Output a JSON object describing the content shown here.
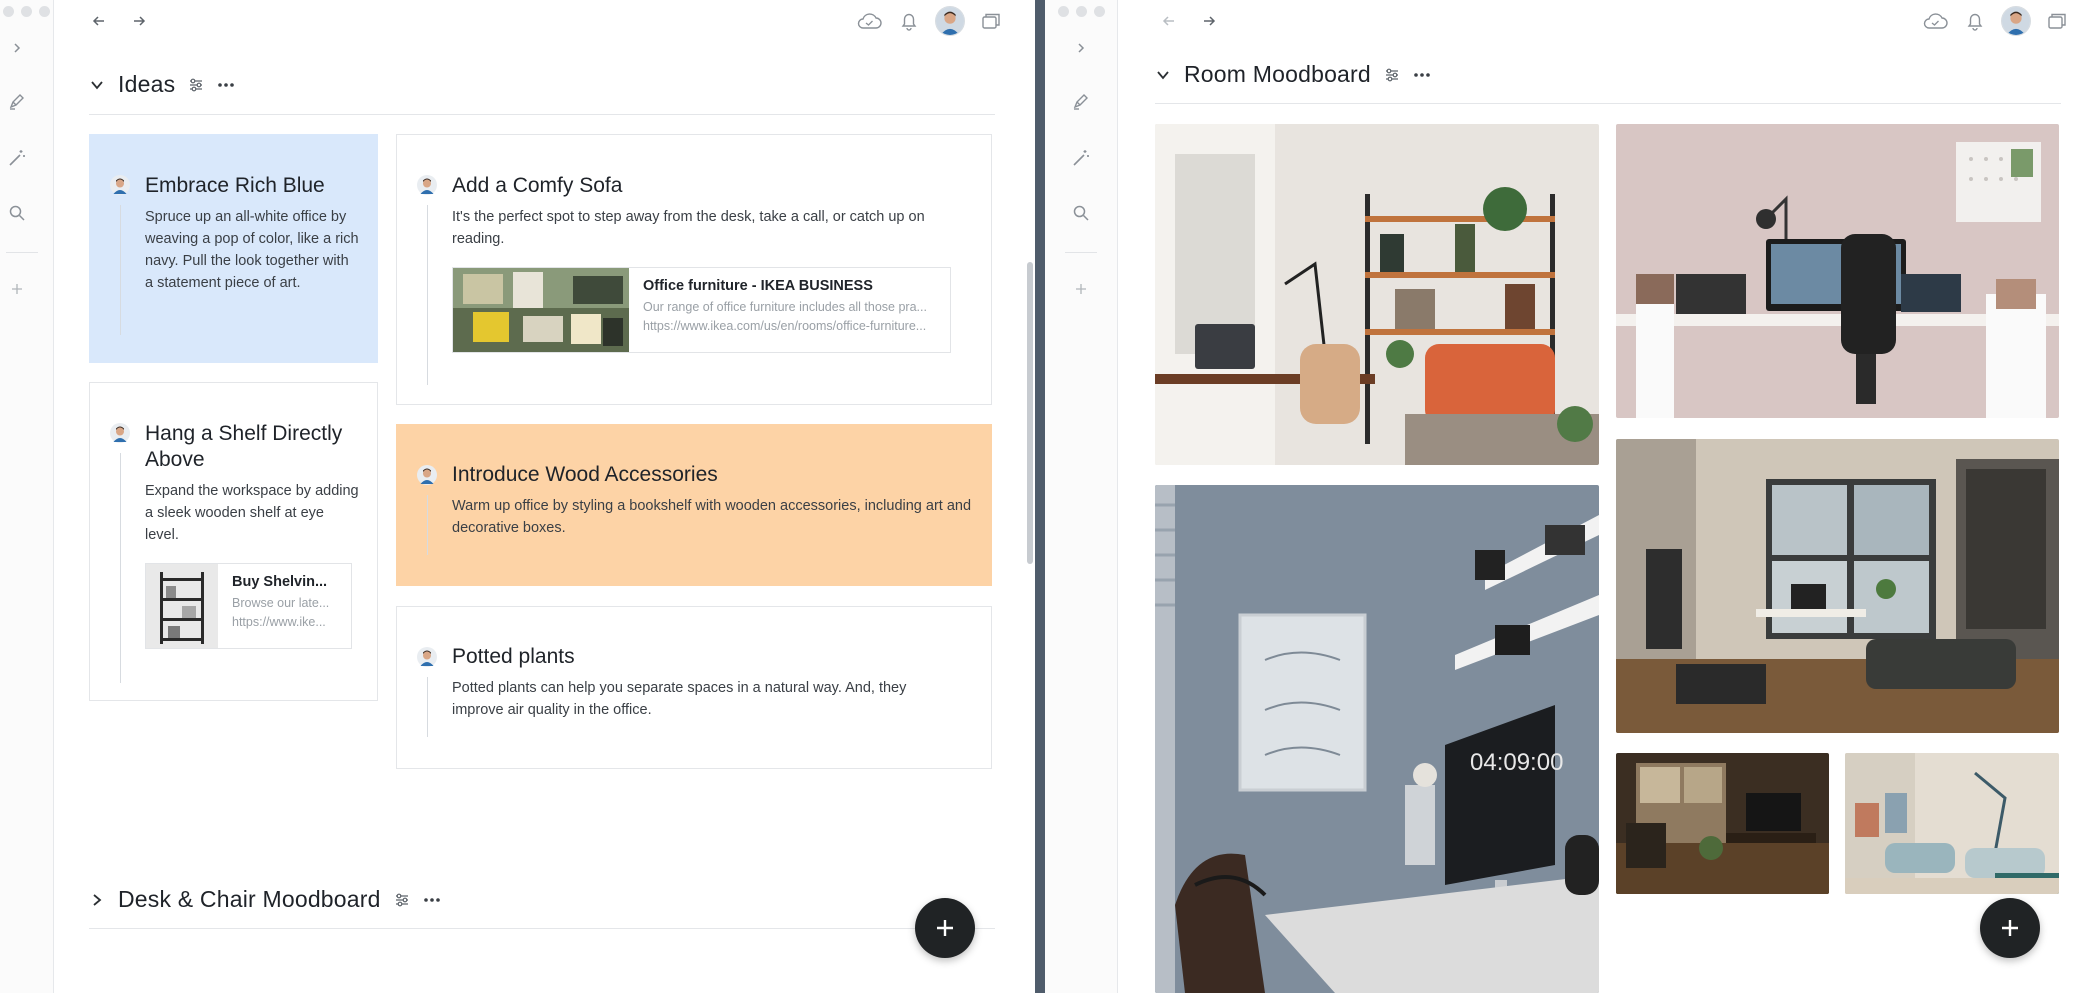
{
  "left_pane": {
    "sections": [
      {
        "title": "Ideas",
        "expanded": true,
        "cards": [
          {
            "title": "Embrace Rich Blue",
            "description": "Spruce up an all-white office by weaving a pop of color, like a rich navy. Pull the look together with a statement piece of art.",
            "color": "#d9e8fb"
          },
          {
            "title": "Add a Comfy Sofa",
            "description": "It's the perfect spot to step away from the desk, take a call, or catch up on reading.",
            "link": {
              "title": "Office furniture - IKEA BUSINESS",
              "description": "Our range of office furniture includes all those pra...",
              "url": "https://www.ikea.com/us/en/rooms/office-furniture..."
            }
          },
          {
            "title": "Hang a Shelf Directly Above",
            "description": "Expand the workspace by adding a sleek wooden shelf at eye level.",
            "link": {
              "title": "Buy Shelvin...",
              "description": "Browse our late...",
              "url": "https://www.ike..."
            }
          },
          {
            "title": "Introduce Wood Accessories",
            "description": "Warm up office by styling a bookshelf with wooden accessories, including art and decorative boxes.",
            "color": "#fdd3a6"
          },
          {
            "title": "Potted plants",
            "description": "Potted plants can help you separate spaces in a natural way. And, they improve air quality in the office."
          }
        ]
      },
      {
        "title": "Desk & Chair Moodboard",
        "expanded": false
      }
    ]
  },
  "right_pane": {
    "section": {
      "title": "Room Moodboard",
      "expanded": true
    },
    "photos": [
      "photo-living-room-shelves",
      "photo-desk-setup-pegboard",
      "photo-desk-imac-clock",
      "photo-bright-loft-room",
      "photo-dark-studio-room",
      "photo-teal-chairs-room"
    ]
  },
  "icons": {
    "nav_back": "arrow-left-icon",
    "nav_forward": "arrow-right-icon",
    "sync": "cloud-icon",
    "notifications": "bell-icon",
    "windows": "window-stack-icon",
    "rail": [
      "chevron-right-icon",
      "pen-icon",
      "magic-wand-icon",
      "search-icon",
      "plus-icon"
    ],
    "section_settings": "sliders-icon",
    "section_more": "ellipsis-icon",
    "fab": "plus-icon"
  },
  "colors": {
    "blue_card": "#d9e8fb",
    "orange_card": "#fdd3a6",
    "divider": "#4f5c6b",
    "fab": "#202325"
  }
}
